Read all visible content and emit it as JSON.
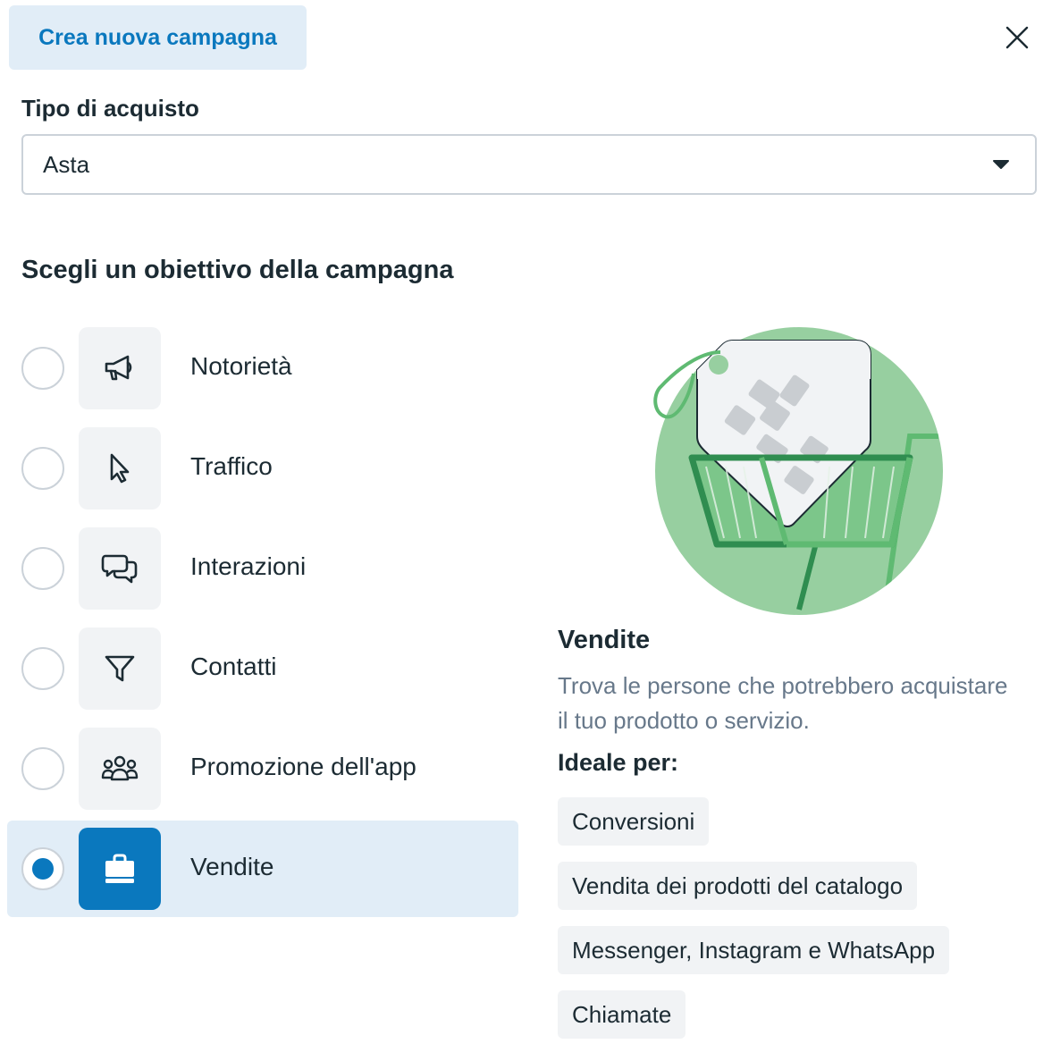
{
  "header": {
    "tab_label": "Crea nuova campagna"
  },
  "purchase_type": {
    "label": "Tipo di acquisto",
    "value": "Asta"
  },
  "objective": {
    "title": "Scegli un obiettivo della campagna",
    "options": [
      {
        "label": "Notorietà",
        "icon": "megaphone-icon",
        "selected": false
      },
      {
        "label": "Traffico",
        "icon": "cursor-icon",
        "selected": false
      },
      {
        "label": "Interazioni",
        "icon": "chat-bubbles-icon",
        "selected": false
      },
      {
        "label": "Contatti",
        "icon": "funnel-icon",
        "selected": false
      },
      {
        "label": "Promozione dell'app",
        "icon": "people-group-icon",
        "selected": false
      },
      {
        "label": "Vendite",
        "icon": "shopping-bag-icon",
        "selected": true
      }
    ]
  },
  "detail": {
    "title": "Vendite",
    "description": "Trova le persone che potrebbero acquistare il tuo prodotto o servizio.",
    "ideal_label": "Ideale per:",
    "tags": [
      "Conversioni",
      "Vendita dei prodotti del catalogo",
      "Messenger, Instagram e WhatsApp",
      "Chiamate"
    ]
  },
  "colors": {
    "accent": "#0a78be",
    "selected_bg": "#e1edf7",
    "illustration_green": "#97cfa0"
  }
}
